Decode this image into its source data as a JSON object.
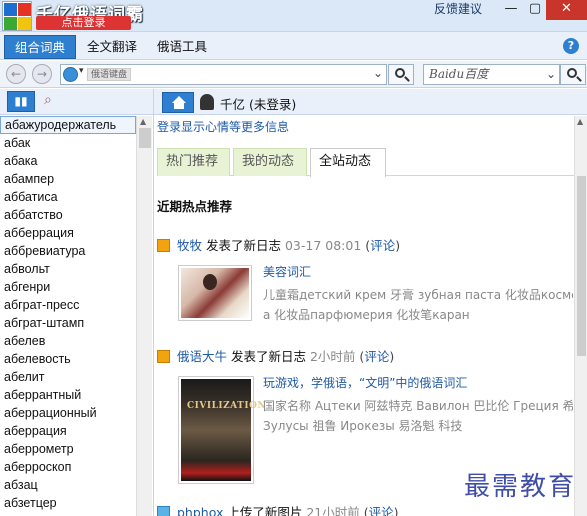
{
  "window": {
    "app_title": "千亿俄语词霸",
    "login_button": "点击登录",
    "feedback_link": "反馈建议",
    "minimize": "—",
    "maximize": "▢",
    "close": "✕"
  },
  "menu": {
    "tabs": [
      "组合词典",
      "全文翻译",
      "俄语工具"
    ],
    "help": "?"
  },
  "toolbar": {
    "address_tag": "俄语键盘",
    "search_engine": "Baidu百度"
  },
  "left_panel": {
    "selected_word": "абажуродержатель",
    "words": [
      "абажуродержатель",
      "абак",
      "абака",
      "абампер",
      "аббатиса",
      "аббатство",
      "абберрация",
      "аббревиатура",
      "абвольт",
      "абгенри",
      "абграт-пресс",
      "абграт-штамп",
      "абелев",
      "абелевость",
      "абелит",
      "аберрантный",
      "аберрационный",
      "аберрация",
      "аберрометр",
      "аберроскоп",
      "абзац",
      "абзетцер"
    ]
  },
  "right_panel": {
    "user_name": "千亿 (未登录)",
    "login_hint": "登录显示心情等更多信息",
    "tabs": [
      "热门推荐",
      "我的动态",
      "全站动态"
    ],
    "active_tab": "全站动态",
    "section_title": "近期热点推荐",
    "feed": [
      {
        "user": "牧牧",
        "action": "发表了新日志",
        "time": "03-17 08:01",
        "comment": "评论",
        "title": "美容词汇",
        "tags_line1": "儿童霜детский крем 牙膏 зубная паста  化妆品косметик",
        "tags_line2": "а  化妆品парфюмерия  化妆笔каран"
      },
      {
        "user": "俄语大牛",
        "action": "发表了新日志",
        "time": "2小时前",
        "comment": "评论",
        "title": "玩游戏，学俄语，“文明”中的俄语词汇",
        "tags_line1": "国家名称 Ацтеки 阿兹特克  Вавилон 巴比伦  Греция 希腊",
        "tags_line2": "Зулусы 祖鲁  Ирокезы 易洛魁  科技",
        "image_text": "CIVILIZATION"
      },
      {
        "user": "phphox",
        "action": "上传了新图片",
        "time": "21小时前",
        "comment": "评论"
      }
    ]
  },
  "watermark": "最需教育"
}
